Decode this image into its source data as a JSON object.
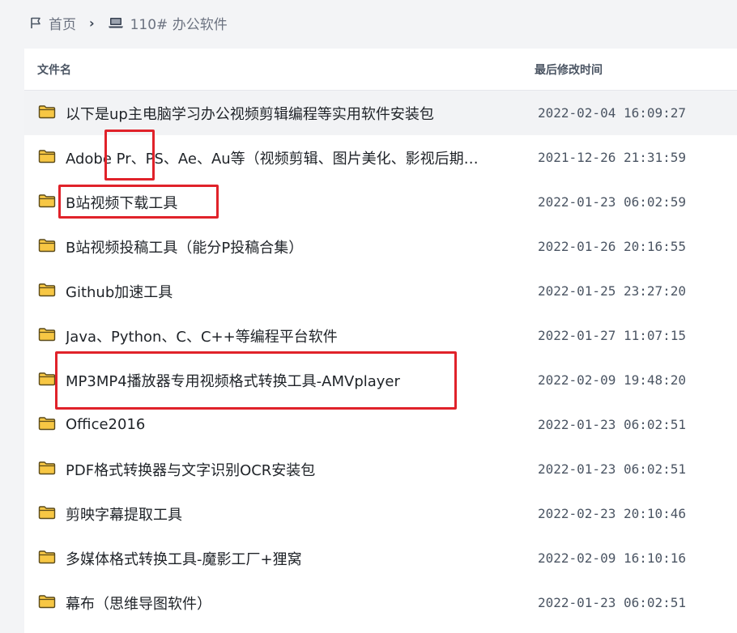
{
  "breadcrumb": {
    "home_label": "首页",
    "current_label": "110# 办公软件"
  },
  "table": {
    "col_name": "文件名",
    "col_modified": "最后修改时间",
    "rows": [
      {
        "name": "以下是up主电脑学习办公视频剪辑编程等实用软件安装包",
        "modified": "2022-02-04 16:09:27"
      },
      {
        "name": "Adobe Pr、PS、Ae、Au等（视频剪辑、图片美化、影视后期…",
        "modified": "2021-12-26 21:31:59"
      },
      {
        "name": "B站视频下载工具",
        "modified": "2022-01-23 06:02:59"
      },
      {
        "name": "B站视频投稿工具（能分P投稿合集）",
        "modified": "2022-01-26 20:16:55"
      },
      {
        "name": "Github加速工具",
        "modified": "2022-01-25 23:27:20"
      },
      {
        "name": "Java、Python、C、C++等编程平台软件",
        "modified": "2022-01-27 11:07:15"
      },
      {
        "name": "MP3MP4播放器专用视频格式转换工具-AMVplayer",
        "modified": "2022-02-09 19:48:20"
      },
      {
        "name": "Office2016",
        "modified": "2022-01-23 06:02:51"
      },
      {
        "name": "PDF格式转换器与文字识别OCR安装包",
        "modified": "2022-01-23 06:02:51"
      },
      {
        "name": "剪映字幕提取工具",
        "modified": "2022-02-23 20:10:46"
      },
      {
        "name": "多媒体格式转换工具-魔影工厂+狸窝",
        "modified": "2022-02-09 16:10:16"
      },
      {
        "name": "幕布（思维导图软件）",
        "modified": "2022-01-23 06:02:51"
      }
    ]
  },
  "colors": {
    "folder_fill": "#f7c744",
    "folder_stroke": "#5a4a1a",
    "highlight": "#e0222a"
  }
}
